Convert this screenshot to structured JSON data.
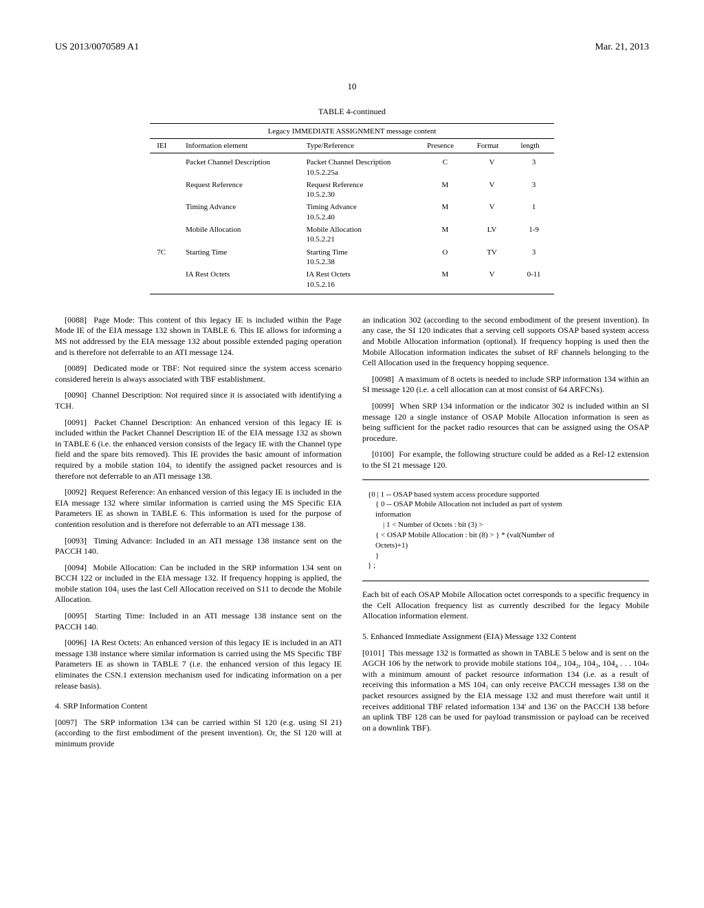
{
  "header": {
    "pub_number": "US 2013/0070589 A1",
    "date": "Mar. 21, 2013",
    "page": "10"
  },
  "table": {
    "caption": "TABLE 4-continued",
    "subcaption": "Legacy IMMEDIATE ASSIGNMENT message content",
    "cols": [
      "IEI",
      "Information element",
      "Type/Reference",
      "Presence",
      "Format",
      "length"
    ],
    "rows": [
      {
        "iei": "",
        "ie": "Packet Channel Description",
        "type": "Packet Channel Description\n10.5.2.25a",
        "presence": "C",
        "format": "V",
        "length": "3"
      },
      {
        "iei": "",
        "ie": "Request Reference",
        "type": "Request Reference\n10.5.2.30",
        "presence": "M",
        "format": "V",
        "length": "3"
      },
      {
        "iei": "",
        "ie": "Timing Advance",
        "type": "Timing Advance\n10.5.2.40",
        "presence": "M",
        "format": "V",
        "length": "1"
      },
      {
        "iei": "",
        "ie": "Mobile Allocation",
        "type": "Mobile Allocation\n10.5.2.21",
        "presence": "M",
        "format": "LV",
        "length": "1-9"
      },
      {
        "iei": "7C",
        "ie": "Starting Time",
        "type": "Starting Time\n10.5.2.38",
        "presence": "O",
        "format": "TV",
        "length": "3"
      },
      {
        "iei": "",
        "ie": "IA Rest Octets",
        "type": "IA Rest Octets\n10.5.2.16",
        "presence": "M",
        "format": "V",
        "length": "0-11"
      }
    ]
  },
  "left": {
    "p0088": "Page Mode: This content of this legacy IE is included within the Page Mode IE of the EIA message 132 shown in TABLE 6. This IE allows for informing a MS not addressed by the EIA message 132 about possible extended paging operation and is therefore not deferrable to an ATI message 124.",
    "p0089": "Dedicated mode or TBF: Not required since the system access scenario considered herein is always associated with TBF establishment.",
    "p0090": "Channel Description: Not required since it is associated with identifying a TCH.",
    "p0091": "Packet Channel Description: An enhanced version of this legacy IE is included within the Packet Channel Description IE of the EIA message 132 as shown in TABLE 6 (i.e. the enhanced version consists of the legacy IE with the Channel type field and the spare bits removed). This IE provides the basic amount of information required by a mobile station 104₁ to identify the assigned packet resources and is therefore not deferrable to an ATI message 138.",
    "p0092": "Request Reference: An enhanced version of this legacy IE is included in the EIA message 132 where similar information is carried using the MS Specific EIA Parameters IE as shown in TABLE 6. This information is used for the purpose of contention resolution and is therefore not deferrable to an ATI message 138.",
    "p0093": "Timing Advance: Included in an ATI message 138 instance sent on the PACCH 140.",
    "p0094": "Mobile Allocation: Can be included in the SRP information 134 sent on BCCH 122 or included in the EIA message 132. If frequency hopping is applied, the mobile station 104₁ uses the last Cell Allocation received on S11 to decode the Mobile Allocation.",
    "p0095": "Starting Time: Included in an ATI message 138 instance sent on the PACCH 140.",
    "p0096": "IA Rest Octets: An enhanced version of this legacy IE is included in an ATI message 138 instance where similar information is carried using the MS Specific TBF Parameters IE as shown in TABLE 7 (i.e. the enhanced version of this legacy IE eliminates the CSN.1 extension mechanism used for indicating information on a per release basis).",
    "h4": "4. SRP Information Content",
    "p0097": "The SRP information 134 can be carried within SI 120 (e.g. using SI 21) (according to the first embodiment of the present invention). Or, the SI 120 will at minimum provide"
  },
  "right": {
    "cont": "an indication 302 (according to the second embodiment of the present invention). In any case, the SI 120 indicates that a serving cell supports OSAP based system access and Mobile Allocation information (optional). If frequency hopping is used then the Mobile Allocation information indicates the subset of RF channels belonging to the Cell Allocation used in the frequency hopping sequence.",
    "p0098": "A maximum of 8 octets is needed to include SRP information 134 within an SI message 120 (i.e. a cell allocation can at most consist of 64 ARFCNs).",
    "p0099": "When SRP 134 information or the indicator 302 is included within an SI message 120 a single instance of OSAP Mobile Allocation information is seen as being sufficient for the packet radio resources that can be assigned using the OSAP procedure.",
    "p0100": "For example, the following structure could be added as a Rel-12 extension to the SI 21 message 120.",
    "code": "{0 | 1 -- OSAP based system access procedure supported\n    { 0 -- OSAP Mobile Allocation not included as part of system\n    information\n        | 1 < Number of Octets : bit (3) >\n    { < OSAP Mobile Allocation : bit (8) > } * (val(Number of\n    Octets)+1)\n    }\n} ;",
    "after_code": "Each bit of each OSAP Mobile Allocation octet corresponds to a specific frequency in the Cell Allocation frequency list as currently described for the legacy Mobile Allocation information element.",
    "h5": "5. Enhanced Immediate Assignment (EIA) Message 132 Content",
    "p0101": "This message 132 is formatted as shown in TABLE 5 below and is sent on the AGCH 106 by the network to provide mobile stations 104₁, 104₂, 104₃, 104₄ . . . 104ₙ with a minimum amount of packet resource information 134 (i.e. as a result of receiving this information a MS 104₁ can only receive PACCH messages 138 on the packet resources assigned by the EIA message 132 and must therefore wait until it receives additional TBF related information 134' and 136' on the PACCH 138 before an uplink TBF 128 can be used for payload transmission or payload can be received on a downlink TBF)."
  }
}
